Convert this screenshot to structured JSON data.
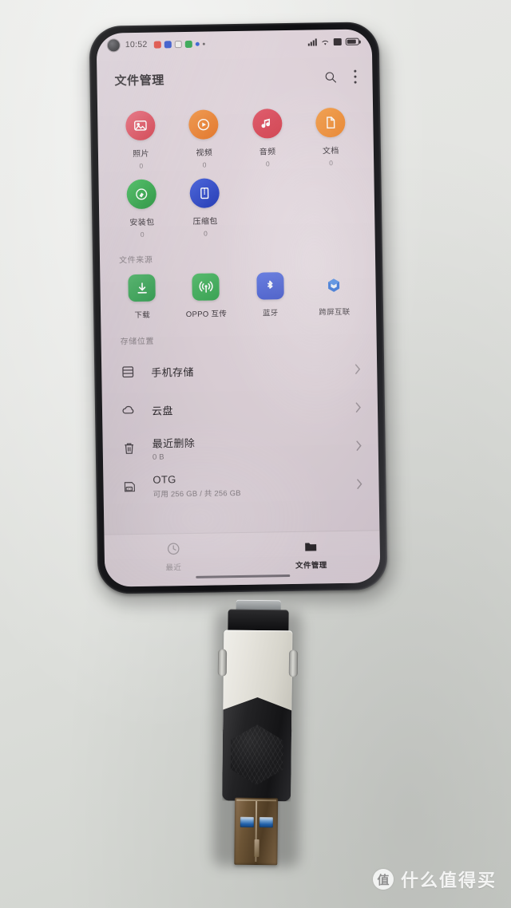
{
  "scene": {
    "description": "Phone running file manager with USB OTG flash drive plugged in, lying on a light gray desk"
  },
  "phone": {
    "statusbar": {
      "time": "10:52",
      "notification_icons": [
        "red-app-icon",
        "blue-app-icon",
        "camera-app-icon",
        "green-app-icon",
        "blue-dot-icon",
        "small-dot-icon"
      ],
      "right_icons": [
        "signal-icon",
        "wifi-icon",
        "alarm-icon",
        "battery-icon"
      ]
    },
    "header": {
      "title": "文件管理",
      "search_icon": "search-icon",
      "more_icon": "more-vertical-icon"
    },
    "categories": [
      {
        "label": "照片",
        "count": "0",
        "icon": "photo-icon",
        "color": "#e05a6a"
      },
      {
        "label": "视频",
        "count": "0",
        "icon": "video-icon",
        "color": "#ef8a3c"
      },
      {
        "label": "音频",
        "count": "0",
        "icon": "audio-icon",
        "color": "#e05060"
      },
      {
        "label": "文档",
        "count": "0",
        "icon": "document-icon",
        "color": "#f0953f"
      },
      {
        "label": "安装包",
        "count": "0",
        "icon": "apk-icon",
        "color": "#36a84f"
      },
      {
        "label": "压缩包",
        "count": "0",
        "icon": "archive-icon",
        "color": "#3355cc"
      }
    ],
    "sources_section": {
      "heading": "文件来源",
      "items": [
        {
          "label": "下载",
          "icon": "download-icon",
          "color": "#3fa85c"
        },
        {
          "label": "OPPO 互传",
          "icon": "share-icon",
          "color": "#46b05e"
        },
        {
          "label": "蓝牙",
          "icon": "bluetooth-icon",
          "color": "#4a63d8"
        },
        {
          "label": "跨屏互联",
          "icon": "multiscreen-icon",
          "color": "#2f6fd8"
        }
      ]
    },
    "storage_section": {
      "heading": "存储位置",
      "items": [
        {
          "title": "手机存储",
          "subtitle": "",
          "icon": "phone-storage-icon",
          "chevron": "chevron-right-icon"
        },
        {
          "title": "云盘",
          "subtitle": "",
          "icon": "cloud-icon",
          "chevron": "chevron-right-icon"
        },
        {
          "title": "最近删除",
          "subtitle": "0 B",
          "icon": "trash-icon",
          "chevron": "chevron-right-icon"
        },
        {
          "title": "OTG",
          "subtitle": "可用 256 GB / 共 256 GB",
          "icon": "otg-icon",
          "chevron": "chevron-right-icon"
        }
      ]
    },
    "bottom_nav": [
      {
        "label": "最近",
        "icon": "clock-icon",
        "active": false
      },
      {
        "label": "文件管理",
        "icon": "folder-icon",
        "active": true
      }
    ]
  },
  "usb_drive": {
    "connector_top": "usb-c-connector",
    "connector_bottom": "usb-a-connector",
    "body_colors": {
      "upper": "#e6e4dd",
      "lower": "#1b1b1d",
      "usb_a": "#6d5536",
      "contacts": "#1f5fa8"
    }
  },
  "watermark": {
    "logo_char": "值",
    "text": "什么值得买"
  }
}
